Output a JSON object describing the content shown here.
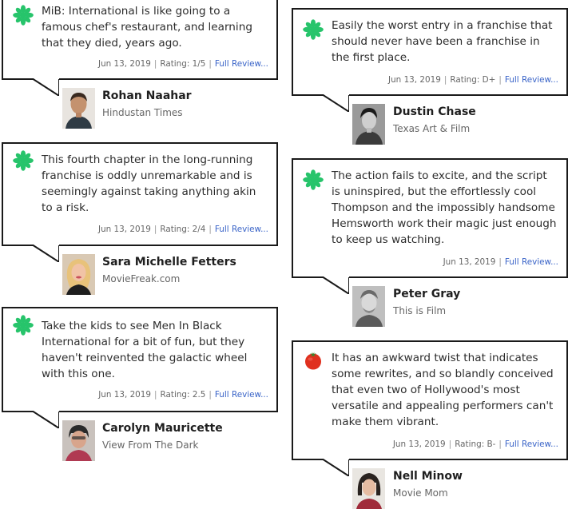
{
  "colors": {
    "fresh_icon": "#27c46b",
    "rotten_icon": "#e0301e",
    "link": "#3a64c8",
    "border": "#1a1a1a"
  },
  "reviews": [
    {
      "icon": "splat-icon",
      "quote": "MiB: International is like going to a famous chef's restaurant, and learning that they died, years ago.",
      "date": "Jun 13, 2019",
      "rating": "Rating: 1/5",
      "link": "Full Review...",
      "critic": "Rohan Naahar",
      "publication": "Hindustan Times"
    },
    {
      "icon": "splat-icon",
      "quote": "This fourth chapter in the long-running franchise is oddly unremarkable and is seemingly against taking anything akin to a risk.",
      "date": "Jun 13, 2019",
      "rating": "Rating: 2/4",
      "link": "Full Review...",
      "critic": "Sara Michelle Fetters",
      "publication": "MovieFreak.com"
    },
    {
      "icon": "splat-icon",
      "quote": "Take the kids to see Men In Black International for a bit of fun, but they haven't reinvented the galactic wheel with this one.",
      "date": "Jun 13, 2019",
      "rating": "Rating: 2.5",
      "link": "Full Review...",
      "critic": "Carolyn Mauricette",
      "publication": "View From The Dark"
    },
    {
      "icon": "splat-icon",
      "quote": "Easily the worst entry in a franchise that should never have been a franchise in the first place.",
      "date": "Jun 13, 2019",
      "rating": "Rating: D+",
      "link": "Full Review...",
      "critic": "Dustin Chase",
      "publication": "Texas Art & Film"
    },
    {
      "icon": "splat-icon",
      "quote": "The action fails to excite, and the script is uninspired, but the effortlessly cool Thompson and the impossibly handsome Hemsworth work their magic just enough to keep us watching.",
      "date": "Jun 13, 2019",
      "rating": "",
      "link": "Full Review...",
      "critic": "Peter Gray",
      "publication": "This is Film"
    },
    {
      "icon": "tomato-icon",
      "quote": "It has an awkward twist that indicates some rewrites, and so blandly conceived that even two of Hollywood's most versatile and appealing performers can't make them vibrant.",
      "date": "Jun 13, 2019",
      "rating": "Rating: B-",
      "link": "Full Review...",
      "critic": "Nell Minow",
      "publication": "Movie Mom"
    }
  ]
}
